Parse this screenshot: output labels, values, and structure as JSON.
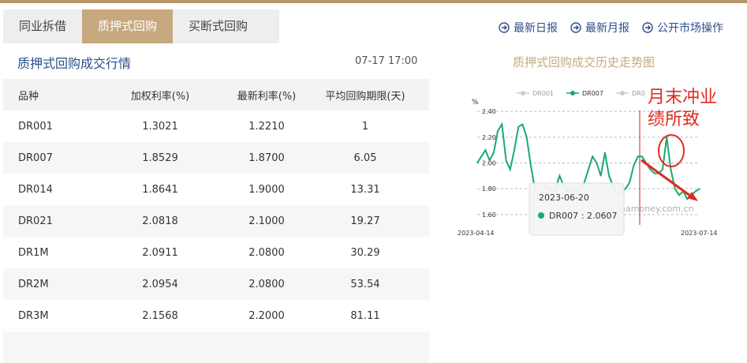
{
  "tabs": [
    {
      "label": "同业拆借",
      "active": false
    },
    {
      "label": "质押式回购",
      "active": true
    },
    {
      "label": "买断式回购",
      "active": false
    }
  ],
  "quick_links": [
    {
      "label": "最新日报",
      "icon": "circle-arrow-right-icon"
    },
    {
      "label": "最新月报",
      "icon": "circle-arrow-right-icon"
    },
    {
      "label": "公开市场操作",
      "icon": "circle-arrow-right-icon"
    }
  ],
  "section": {
    "title": "质押式回购成交行情",
    "timestamp": "07-17 17:00"
  },
  "table": {
    "headers": [
      "品种",
      "加权利率(%)",
      "最新利率(%)",
      "平均回购期限(天)"
    ],
    "rows": [
      [
        "DR001",
        "1.3021",
        "1.2210",
        "1"
      ],
      [
        "DR007",
        "1.8529",
        "1.8700",
        "6.05"
      ],
      [
        "DR014",
        "1.8641",
        "1.9000",
        "13.31"
      ],
      [
        "DR021",
        "2.0818",
        "2.1000",
        "19.27"
      ],
      [
        "DR1M",
        "2.0911",
        "2.0800",
        "30.29"
      ],
      [
        "DR2M",
        "2.0954",
        "2.0800",
        "53.54"
      ],
      [
        "DR3M",
        "2.1568",
        "2.2000",
        "81.11"
      ]
    ]
  },
  "chart_title": "质押式回购成交历史走势图",
  "chart_data": {
    "type": "line",
    "ylabel": "%",
    "ylim": [
      1.55,
      2.45
    ],
    "yticks": [
      "2.40",
      "2.20",
      "2.00",
      "1.80",
      "1.60"
    ],
    "x_start_label": "2023-04-14",
    "x_end_label": "2023-07-14",
    "legend": [
      "DR001",
      "DR007",
      "DR0"
    ],
    "legend_active": "DR007",
    "series": [
      {
        "name": "DR007",
        "color": "#1aa874",
        "values": [
          2.0,
          2.05,
          2.1,
          2.02,
          2.08,
          2.25,
          2.3,
          2.02,
          1.95,
          2.1,
          2.28,
          2.3,
          2.2,
          1.98,
          1.8,
          1.72,
          1.8,
          1.82,
          1.78,
          1.8,
          1.9,
          1.82,
          1.78,
          1.8,
          1.76,
          1.8,
          1.85,
          1.95,
          2.05,
          2.0,
          1.9,
          2.08,
          1.9,
          1.82,
          1.75,
          1.78,
          1.8,
          1.85,
          1.98,
          2.05,
          2.05,
          2.0,
          1.95,
          1.92,
          1.92,
          1.95,
          2.2,
          1.95,
          1.8,
          1.75,
          1.78,
          1.72,
          1.75,
          1.78,
          1.8
        ]
      }
    ],
    "tooltip": {
      "date": "2023-06-20",
      "series": "DR007",
      "value": "2.0607"
    },
    "watermark": "chinamoney.com.cn",
    "annotation": "月末冲业绩所致",
    "annotation_color": "#e02b20"
  }
}
